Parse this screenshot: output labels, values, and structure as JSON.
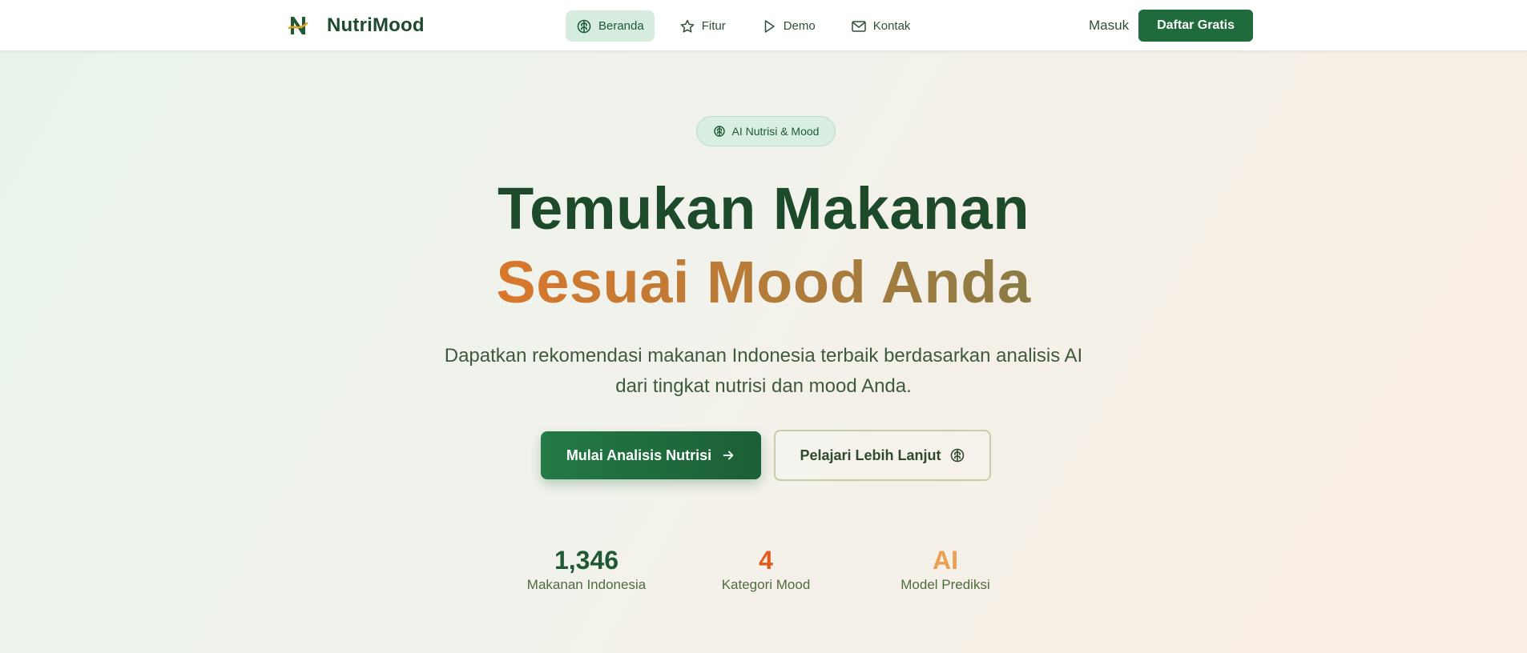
{
  "brand": {
    "name": "NutriMood",
    "logo_letter": "N"
  },
  "nav": {
    "items": [
      {
        "label": "Beranda",
        "icon": "brain-icon",
        "active": true
      },
      {
        "label": "Fitur",
        "icon": "star-icon",
        "active": false
      },
      {
        "label": "Demo",
        "icon": "play-icon",
        "active": false
      },
      {
        "label": "Kontak",
        "icon": "mail-icon",
        "active": false
      }
    ],
    "login_label": "Masuk",
    "signup_label": "Daftar Gratis"
  },
  "hero": {
    "badge_label": "AI Nutrisi & Mood",
    "title_line1": "Temukan Makanan",
    "title_line2": "Sesuai Mood Anda",
    "subtitle": "Dapatkan rekomendasi makanan Indonesia terbaik berdasarkan analisis AI dari tingkat nutrisi dan mood Anda.",
    "primary_cta": "Mulai Analisis Nutrisi",
    "secondary_cta": "Pelajari Lebih Lanjut"
  },
  "stats": [
    {
      "value": "1,346",
      "label": "Makanan Indonesia",
      "color": "#1f5a34"
    },
    {
      "value": "4",
      "label": "Kategori Mood",
      "color": "#e35a1e"
    },
    {
      "value": "AI",
      "label": "Model Prediksi",
      "color": "#e9a052"
    }
  ],
  "colors": {
    "primary": "#1f6b3c",
    "active_nav_bg": "#d6ecdf",
    "title_dark": "#1c4a2a",
    "accent_orange": "#d9772c"
  }
}
